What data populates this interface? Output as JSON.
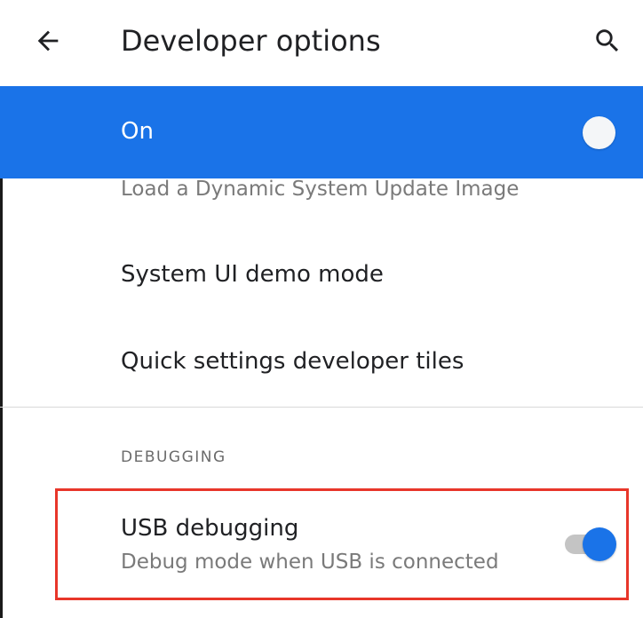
{
  "appbar": {
    "title": "Developer options",
    "back_icon": "arrow-back-icon",
    "search_icon": "search-icon"
  },
  "master_switch": {
    "label": "On",
    "checked": true,
    "color": "#1a73e8"
  },
  "list": {
    "partial_item": "Load a Dynamic System Update Image",
    "items": [
      {
        "title": "System UI demo mode"
      },
      {
        "title": "Quick settings developer tiles"
      }
    ]
  },
  "debugging": {
    "header": "DEBUGGING",
    "usb_debugging": {
      "title": "USB debugging",
      "summary": "Debug mode when USB is connected",
      "checked": true
    },
    "highlight_color": "#e8362a"
  }
}
